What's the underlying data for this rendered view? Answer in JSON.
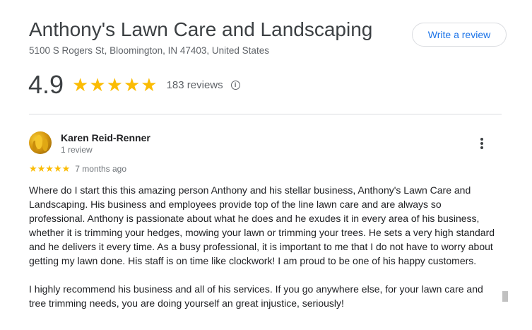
{
  "business": {
    "name": "Anthony's Lawn Care and Landscaping",
    "address": "5100 S Rogers St, Bloomington, IN 47403, United States",
    "write_review_label": "Write a review"
  },
  "summary": {
    "rating": "4.9",
    "stars": "★★★★★",
    "review_count": "183 reviews",
    "info_icon": "info-icon",
    "info_glyph": "i"
  },
  "review": {
    "reviewer_name": "Karen Reid-Renner",
    "reviewer_meta": "1 review",
    "stars": "★★★★★",
    "date": "7 months ago",
    "paragraph_1": "Where do I start this this amazing person Anthony and his stellar business, Anthony's Lawn Care and Landscaping. His business and employees provide top of the line lawn care and are always so professional. Anthony is passionate about what he does and he exudes it in every area of his business, whether it is trimming your hedges, mowing your lawn or trimming your trees. He sets a very high standard and he delivers it every time. As a busy professional, it is important to me that I do not have to worry about getting my lawn done. His staff is on time like clockwork! I am proud to be one of his happy customers.",
    "paragraph_2": "I highly recommend his business and all of his services. If you go anywhere else, for your lawn care and tree trimming needs, you are doing yourself an great injustice, seriously!",
    "more_icon": "more-vert-icon"
  },
  "colors": {
    "star": "#fbbc04",
    "link_blue": "#1a73e8",
    "secondary_text": "#5f6368",
    "divider": "#dadce0"
  }
}
